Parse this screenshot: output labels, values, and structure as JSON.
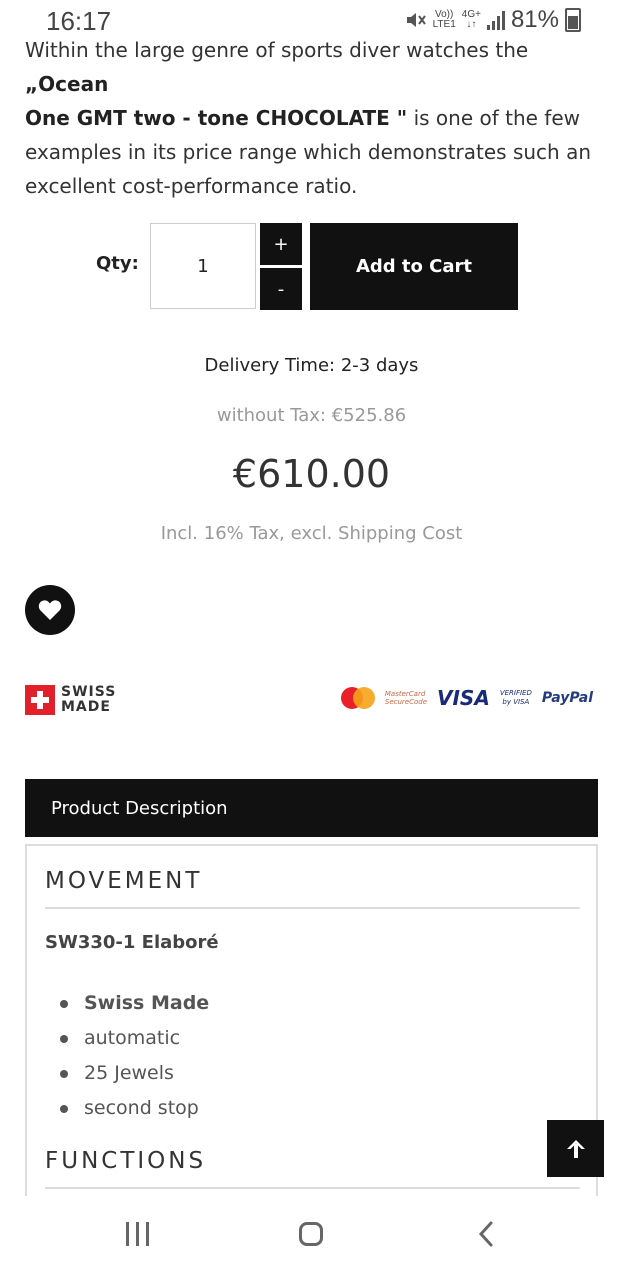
{
  "status_bar": {
    "time": "16:17",
    "volte": "Vo))",
    "lte": "LTE1",
    "network": "4G+",
    "battery": "81%"
  },
  "intro": {
    "text_before": "Within the large genre of sports diver watches the ",
    "highlight_quote": "„Ocean",
    "highlight_name": "One GMT two - tone CHOCOLATE  \"",
    "text_after": " is one of the few examples in its price range which demonstrates such an excellent cost-performance ratio."
  },
  "purchase": {
    "qty_label": "Qty:",
    "qty_value": "1",
    "plus_label": "+",
    "minus_label": "-",
    "add_to_cart_label": "Add to Cart"
  },
  "pricing": {
    "delivery": "Delivery Time: 2-3 days",
    "without_tax": "without Tax: €525.86",
    "price": "€610.00",
    "tax_note": "Incl. 16% Tax, excl. Shipping Cost"
  },
  "badges": {
    "swiss_line1": "SWISS",
    "swiss_line2": "MADE",
    "mc_secure_line1": "MasterCard",
    "mc_secure_line2": "SecureCode",
    "visa": "VISA",
    "vbv_line1": "VERIFIED",
    "vbv_line2": "by VISA",
    "paypal": "PayPal"
  },
  "description": {
    "tab_label": "Product Description",
    "movement_title": "MOVEMENT",
    "caliber": "SW330-1 Elaboré",
    "features": [
      "Swiss Made",
      "automatic",
      "25 Jewels",
      "second stop"
    ],
    "functions_title": "FUNCTIONS"
  },
  "colors": {
    "button_bg": "#111111",
    "swiss_red": "#e2202b",
    "muted_text": "#999999"
  },
  "icons": [
    "heart-icon",
    "arrow-up-icon",
    "recent-apps-icon",
    "home-icon",
    "back-icon",
    "mute-icon",
    "signal-icon",
    "battery-icon"
  ]
}
